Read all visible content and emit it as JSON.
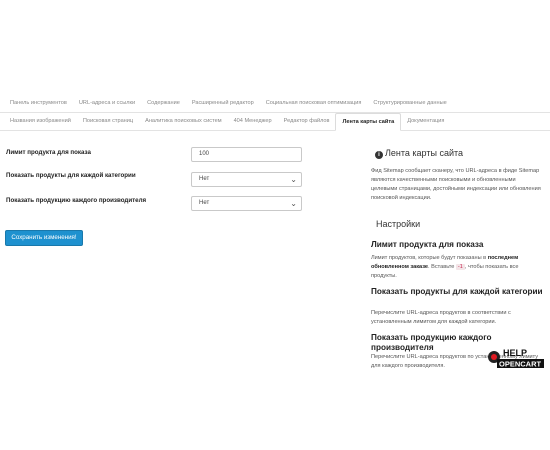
{
  "tabs": {
    "row1": [
      "Панель инструментов",
      "URL-адреса и ссылки",
      "Содержание",
      "Расширенный редактор",
      "Социальная поисковая оптимизация",
      "Структурированные данные"
    ],
    "row2": [
      "Названия изображений",
      "Поисковая страниц",
      "Аналитика поисковых систем",
      "404 Менеджер",
      "Редактор файлов",
      "Лента карты сайта",
      "Документация"
    ],
    "active": "Лента карты сайта"
  },
  "form": {
    "limit_label": "Лимит продукта для показа",
    "limit_value": "100",
    "per_category_label": "Показать продукты для каждой категории",
    "per_category_value": "Нет",
    "per_manufacturer_label": "Показать продукцию каждого производителя",
    "per_manufacturer_value": "Нет",
    "save_label": "Сохранить изменения!"
  },
  "sidebar": {
    "title": "Лента карты сайта",
    "title_icon": "info-icon",
    "intro": "Фид Sitemap сообщает сканеру, что URL-адреса в фиде Sitemap являются качественными поисковыми и обновленными целевыми страницами, достойными индексации или обновления поисковой индексации.",
    "settings_heading": "Настройки",
    "s1_heading": "Лимит продукта для показа",
    "s1_text_a": "Лимит продуктов, которые будут показаны в",
    "s1_bold": "последнем обновленном заказе",
    "s1_text_b": ". Вставьте",
    "s1_code": "-1",
    "s1_text_c": ", чтобы показать все продукты.",
    "s2_heading": "Показать продукты для каждой категории",
    "s2_text": "Перечислите URL-адреса продуктов в соответствии с установленным лимитом для каждой категории.",
    "s3_heading": "Показать продукцию каждого производителя",
    "s3_text": "Перечислите URL-адреса продуктов по установленному лимиту для каждого производителя."
  },
  "logo": {
    "top": "HELP",
    "bottom": "OPENCART"
  }
}
